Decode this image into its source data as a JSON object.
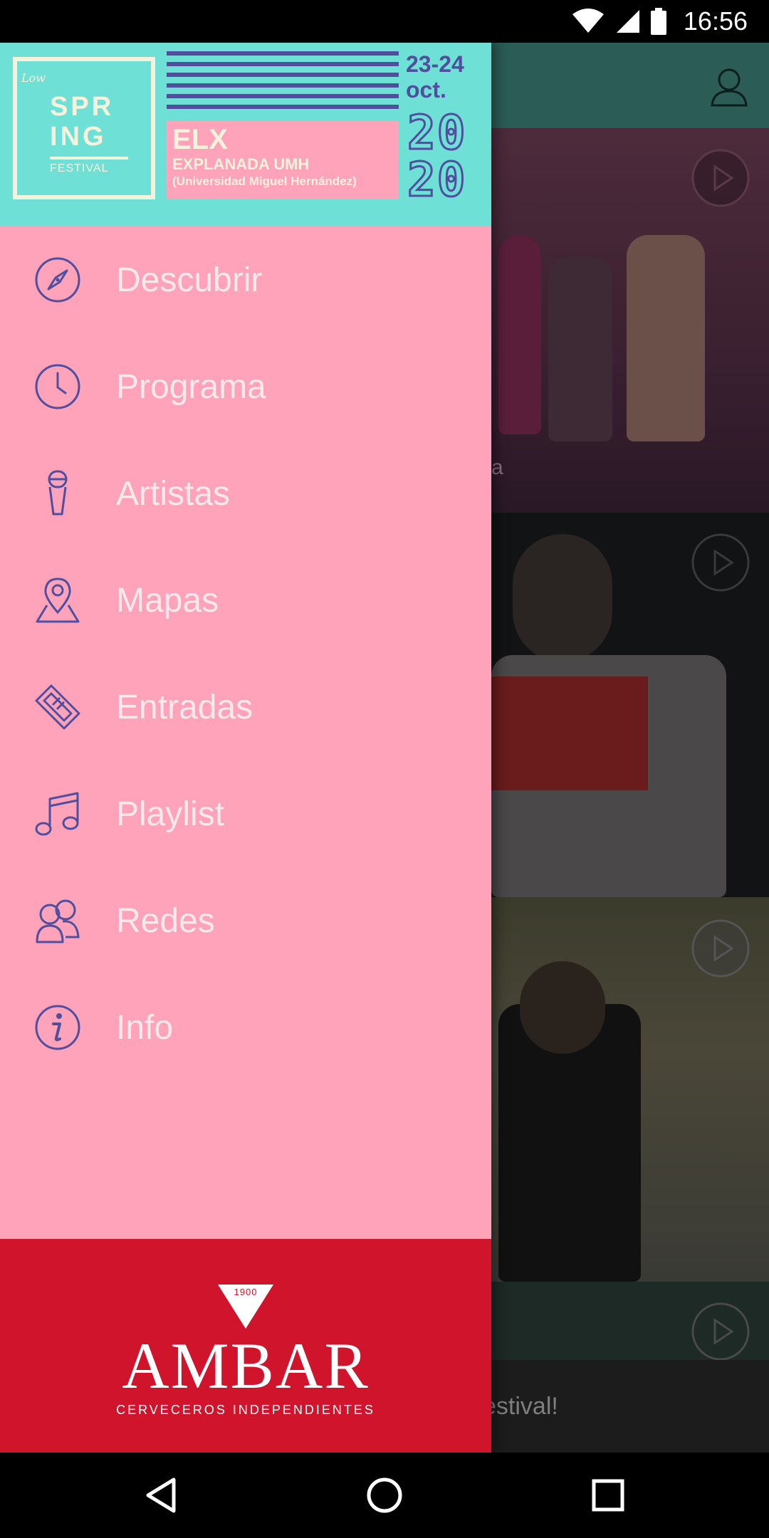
{
  "status_bar": {
    "time": "16:56"
  },
  "header": {
    "logo_low": "Low",
    "logo_line1": "SPR",
    "logo_line2": "ING",
    "logo_line3": "FESTIVAL",
    "city": "ELX",
    "venue": "EXPLANADA UMH",
    "venue_detail": "(Universidad Miguel Hernández)",
    "dates": "23-24",
    "month": "oct.",
    "year_top": "20",
    "year_bottom": "20"
  },
  "menu": {
    "items": [
      {
        "label": "Descubrir",
        "icon": "compass-icon"
      },
      {
        "label": "Programa",
        "icon": "clock-icon"
      },
      {
        "label": "Artistas",
        "icon": "microphone-icon"
      },
      {
        "label": "Mapas",
        "icon": "map-pin-icon"
      },
      {
        "label": "Entradas",
        "icon": "ticket-icon"
      },
      {
        "label": "Playlist",
        "icon": "music-note-icon"
      },
      {
        "label": "Redes",
        "icon": "people-icon"
      },
      {
        "label": "Info",
        "icon": "info-icon"
      }
    ]
  },
  "sponsor": {
    "year": "1900",
    "name": "AMBAR",
    "tagline": "CERVECEROS INDEPENDIENTES"
  },
  "background": {
    "caption_partial": "a",
    "footer_partial": "estival!"
  },
  "colors": {
    "drawer_bg": "#ffa3bb",
    "header_bg": "#6fe0d6",
    "icon_purple": "#4f4f9e",
    "sponsor_red": "#cf142b"
  }
}
